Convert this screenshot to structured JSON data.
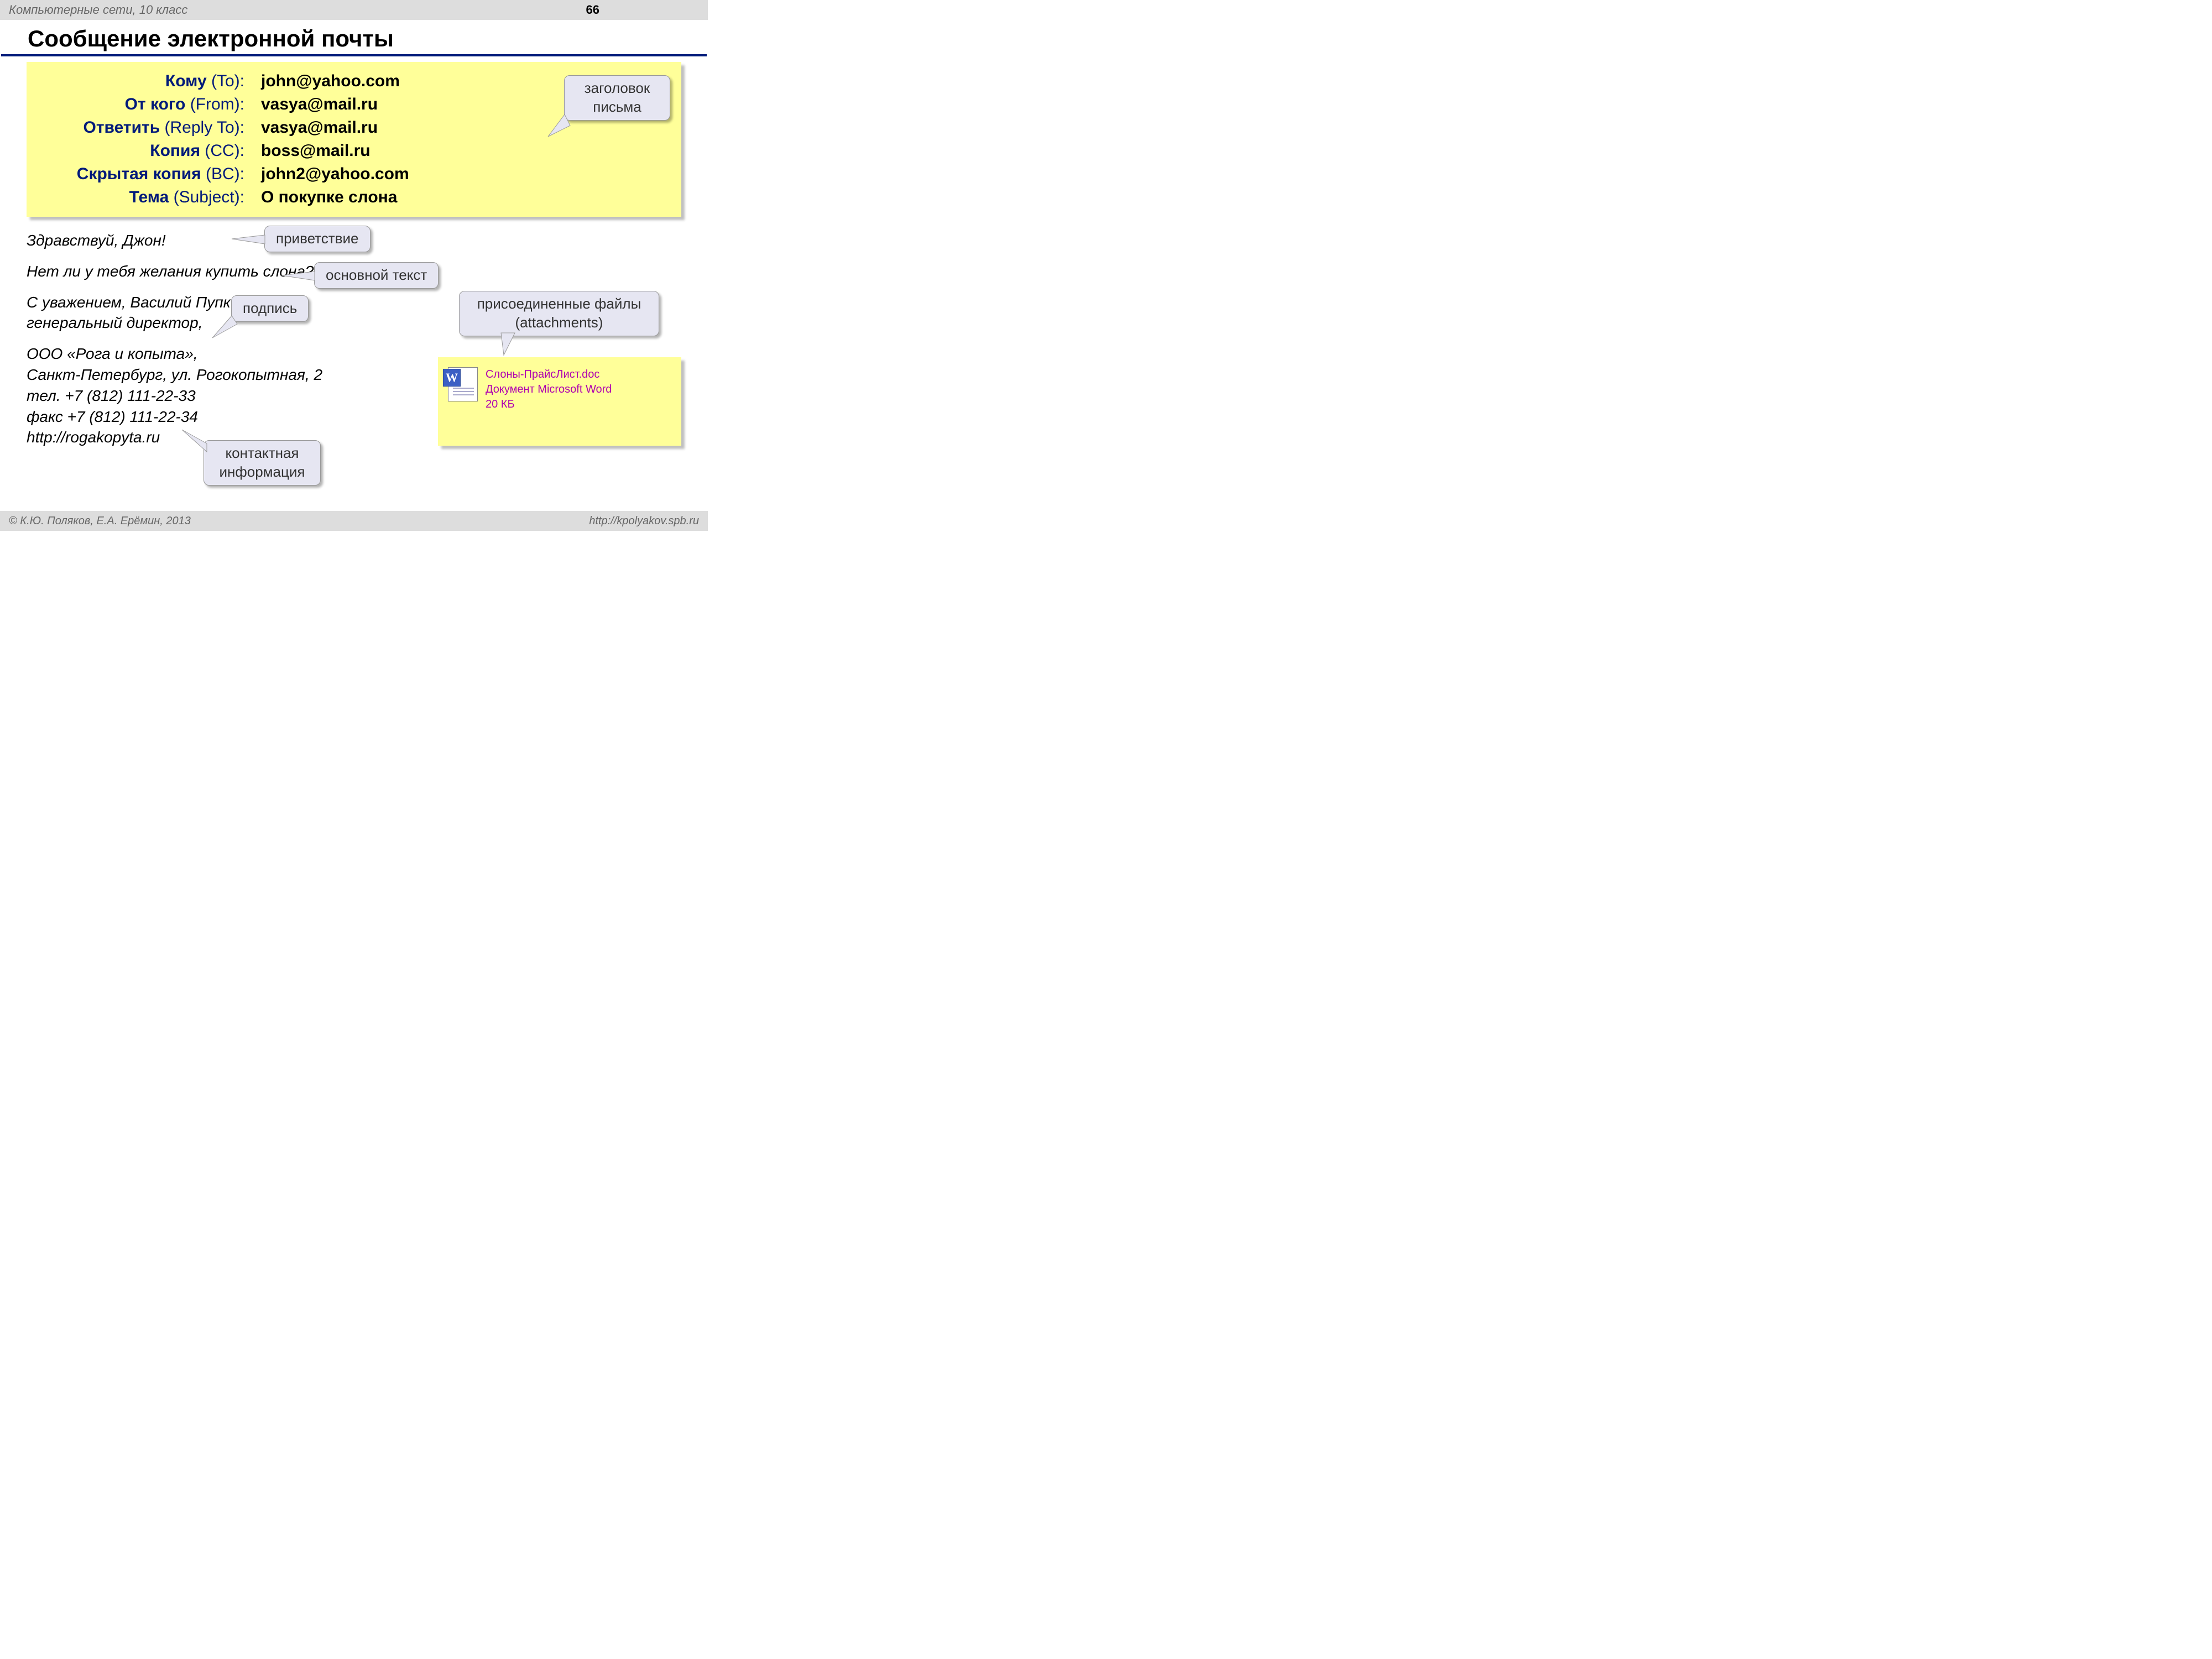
{
  "topbar": {
    "course": "Компьютерные сети, 10 класс",
    "page": "66"
  },
  "title": "Сообщение электронной почты",
  "headers": {
    "to": {
      "ru": "Кому",
      "en": "(To):",
      "val": "john@yahoo.com"
    },
    "from": {
      "ru": "От кого",
      "en": "(From):",
      "val": "vasya@mail.ru"
    },
    "replyto": {
      "ru": "Ответить",
      "en": "(Reply To):",
      "val": "vasya@mail.ru"
    },
    "cc": {
      "ru": "Копия",
      "en": "(CC):",
      "val": "boss@mail.ru"
    },
    "bcc": {
      "ru": "Скрытая копия",
      "en": "(BC):",
      "val": "john2@yahoo.com"
    },
    "subj": {
      "ru": "Тема",
      "en": "(Subject):",
      "val": "О покупке слона"
    }
  },
  "callouts": {
    "header": "заголовок письма",
    "greet": "приветствие",
    "body": "основной текст",
    "sign": "подпись",
    "attach1": "присоединенные файлы",
    "attach2": "(attachments)",
    "contact1": "контактная",
    "contact2": "информация"
  },
  "body": {
    "greet": "Здравствуй, Джон!",
    "main": "Нет ли у тебя желания купить слона?",
    "sign": "С уважением, Василий Пупкин, генеральный директор,",
    "contact": "ООО «Рога и копыта»,\nСанкт-Петербург, ул. Рогокопытная, 2\nтел. +7 (812) 111-22-33\nфакс +7 (812) 111-22-34\nhttp://rogakopyta.ru"
  },
  "attach": {
    "name": "Слоны-ПрайсЛист.doc",
    "type": "Документ Microsoft Word",
    "size": "20 КБ"
  },
  "footer": {
    "left": "© К.Ю. Поляков, Е.А. Ерёмин, 2013",
    "right": "http://kpolyakov.spb.ru"
  }
}
